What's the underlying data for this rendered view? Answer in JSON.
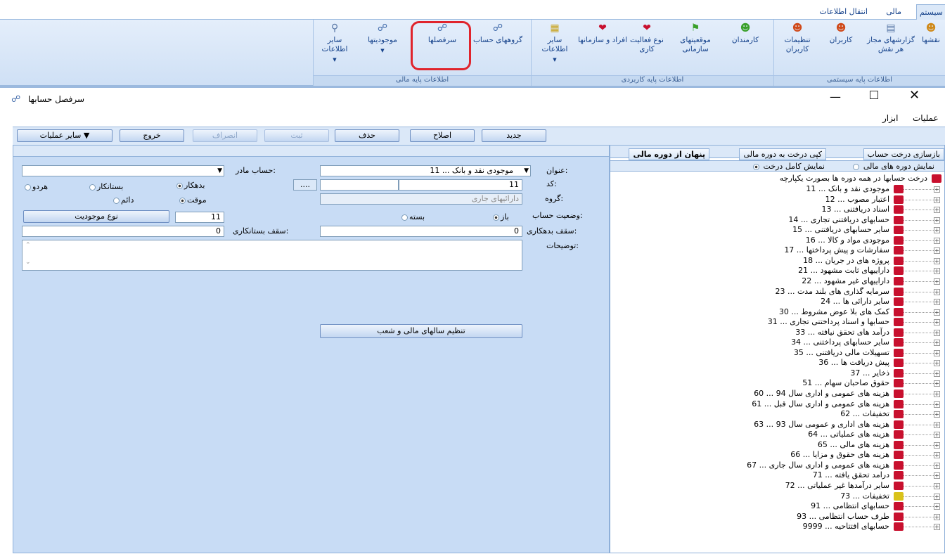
{
  "ribbon_tabs": [
    "سیستم",
    "مالی",
    "انتقال اطلاعات"
  ],
  "ribbon_groups": [
    {
      "label": "اطلاعات پایه سیستمی",
      "buttons": [
        "نقشها",
        "گزارشهای مجاز هر نقش",
        "کاربران",
        "تنظیمات کاربران"
      ]
    },
    {
      "label": "اطلاعات پایه کاربردی",
      "buttons": [
        "کارمندان",
        "موقعیتهای سازمانی",
        "نوع فعالیت کاری",
        "افراد و سازمانها",
        "سایر اطلاعات"
      ]
    },
    {
      "label": "اطلاعات پایه مالی",
      "buttons": [
        "گروههای حساب",
        "سرفصلها",
        "موجودیتها",
        "سایر اطلاعات"
      ]
    }
  ],
  "window": {
    "title": "سرفصل حسابها",
    "menu": [
      "عملیات",
      "ابزار"
    ]
  },
  "toolbar": {
    "new": "جدید",
    "edit": "اصلاح",
    "delete": "حذف",
    "save": "ثبت",
    "cancel": "انصراف",
    "exit": "خروج",
    "other": "سایر عملیات"
  },
  "form": {
    "title_label": "عنوان:",
    "title_value": "11 ... موجودی نقد و بانک",
    "parent_label": "حساب مادر:",
    "parent_value": "",
    "code_label": "کد:",
    "code_value": "11",
    "code_value2": "11",
    "group_label": "گروه:",
    "group_value": "دارائیهای جاری",
    "debit": "بدهکار",
    "credit": "بستانکار",
    "both": "هردو",
    "temp": "موقت",
    "perm": "دائم",
    "status_label": "وضعیت حساب:",
    "open": "باز",
    "closed": "بسته",
    "entity_value": "11",
    "entity_button": "نوع موجودیت",
    "debit_cap_label": "سقف بدهکاری:",
    "debit_cap_value": "0",
    "credit_cap_label": "سقف بستانکاری:",
    "credit_cap_value": "0",
    "desc_label": "توضیحات:",
    "setup_button": "تنظیم سالهای مالی و شعب",
    "ellipsis": "...."
  },
  "right": {
    "tabs": [
      "بازسازی درخت حساب",
      "کپی درخت به دوره مالی",
      "پنهان از دوره مالی"
    ],
    "opt_period": "نمایش دوره های مالی",
    "opt_full": "نمایش کامل درخت",
    "root": "درخت حسابها در همه دوره ها بصورت یکپارچه",
    "items": [
      "11 ... موجودی نقد و بانک",
      "12 ... اعتبار مصوب",
      "13 ... اسناد دریافتنی",
      "14 ... حسابهای دریافتنی تجاری",
      "15 ... سایر حسابهای دریافتنی",
      "16 ... موجودی مواد و کالا",
      "17 ... سفارشات و پیش پرداختها",
      "18 ... پروژه های در جریان",
      "21 ... داراییهای ثابت مشهود",
      "22 ... داراییهای غیر مشهود",
      "23 ... سرمایه گذاری های بلند مدت",
      "24 ... سایر دارائی ها",
      "30 ... کمک های بلا عوض مشروط",
      "31 ... حسابها و اسناد پرداختنی تجاری",
      "33 ... درآمد های تحقق نیافته",
      "34 ... سایر حسابهای پرداختنی",
      "35 ... تسهیلات مالی دریافتنی",
      "36 ... پیش دریافت ها",
      "37 ... ذخایر",
      "51 ... حقوق صاحبان سهام",
      "60 ... هزینه های عمومی و اداری سال 94",
      "61 ... هزینه های عمومی و اداری سال قبل",
      "62 ... تخفیفات",
      "63 ... هزینه های اداری و عمومی سال 93",
      "64 ... هزینه های عملیاتی",
      "65 ... هزینه های مالی",
      "66 ... هزینه های حقوق و مزایا",
      "67 ... هزینه های عمومی و اداری سال جاری",
      "71 ... درامد تحقق یافته",
      "72 ... سایر درآمدها غیر عملیاتی",
      "73 ... تخفیفات",
      "91 ... حسابهای انتظامی",
      "93 ... طرف حساب انتظامی",
      "9999 ... حسابهای افتتاحیه"
    ]
  }
}
